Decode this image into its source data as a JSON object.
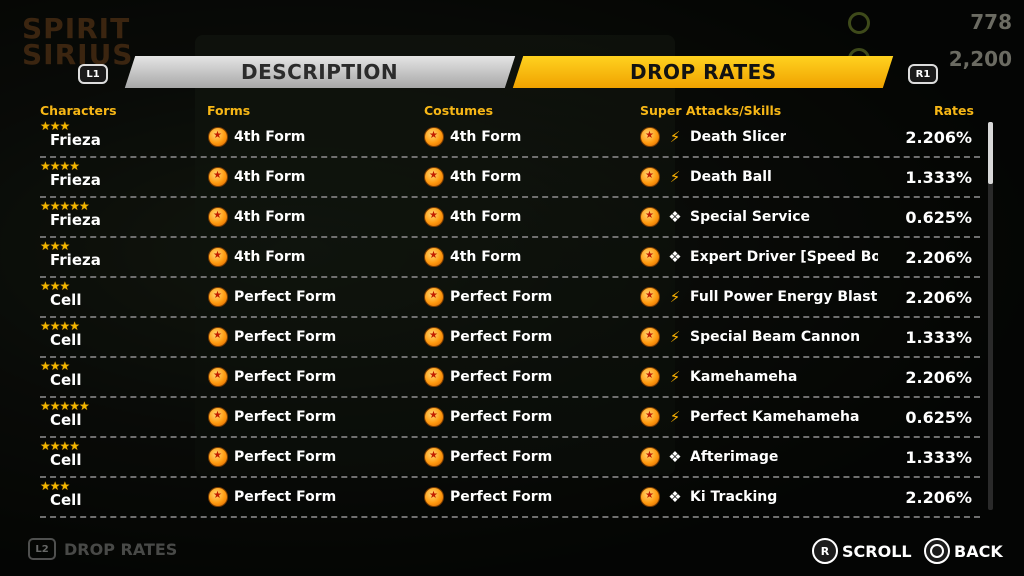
{
  "logo_lines": [
    "SPIRIT",
    "SIRIUS"
  ],
  "currency": [
    "778",
    "2,200"
  ],
  "tabs": {
    "left_button": "L1",
    "right_button": "R1",
    "description": "DESCRIPTION",
    "drop_rates": "DROP RATES"
  },
  "headers": {
    "characters": "Characters",
    "forms": "Forms",
    "costumes": "Costumes",
    "skills": "Super Attacks/Skills",
    "rates": "Rates"
  },
  "rows": [
    {
      "stars": "★★★",
      "character": "Frieza",
      "form": "4th Form",
      "costume": "4th Form",
      "skill_icon": "flame-icon",
      "skill": "Death Slicer",
      "rate": "2.206%"
    },
    {
      "stars": "★★★★",
      "character": "Frieza",
      "form": "4th Form",
      "costume": "4th Form",
      "skill_icon": "flame-icon",
      "skill": "Death Ball",
      "rate": "1.333%"
    },
    {
      "stars": "★★★★★",
      "character": "Frieza",
      "form": "4th Form",
      "costume": "4th Form",
      "skill_icon": "diamond-icon",
      "skill": "Special Service",
      "rate": "0.625%"
    },
    {
      "stars": "★★★",
      "character": "Frieza",
      "form": "4th Form",
      "costume": "4th Form",
      "skill_icon": "diamond-icon",
      "skill": "Expert Driver [Speed Boost]",
      "rate": "2.206%"
    },
    {
      "stars": "★★★",
      "character": "Cell",
      "form": "Perfect Form",
      "costume": "Perfect Form",
      "skill_icon": "flame-icon",
      "skill": "Full Power Energy Blast Volley",
      "rate": "2.206%"
    },
    {
      "stars": "★★★★",
      "character": "Cell",
      "form": "Perfect Form",
      "costume": "Perfect Form",
      "skill_icon": "flame-icon",
      "skill": "Special Beam Cannon",
      "rate": "1.333%"
    },
    {
      "stars": "★★★",
      "character": "Cell",
      "form": "Perfect Form",
      "costume": "Perfect Form",
      "skill_icon": "flame-icon",
      "skill": "Kamehameha",
      "rate": "2.206%"
    },
    {
      "stars": "★★★★★",
      "character": "Cell",
      "form": "Perfect Form",
      "costume": "Perfect Form",
      "skill_icon": "flame-icon",
      "skill": "Perfect Kamehameha",
      "rate": "0.625%"
    },
    {
      "stars": "★★★★",
      "character": "Cell",
      "form": "Perfect Form",
      "costume": "Perfect Form",
      "skill_icon": "diamond-icon",
      "skill": "Afterimage",
      "rate": "1.333%"
    },
    {
      "stars": "★★★",
      "character": "Cell",
      "form": "Perfect Form",
      "costume": "Perfect Form",
      "skill_icon": "diamond-icon",
      "skill": "Ki Tracking",
      "rate": "2.206%"
    }
  ],
  "footer": {
    "l2_button": "L2",
    "l2_label": "DROP RATES",
    "scroll_button": "R",
    "scroll_label": "SCROLL",
    "back_label": "BACK"
  },
  "colors": {
    "accent": "#f7b716",
    "tab_active": "#ffd21f",
    "tab_inactive": "#c8c8c8"
  }
}
